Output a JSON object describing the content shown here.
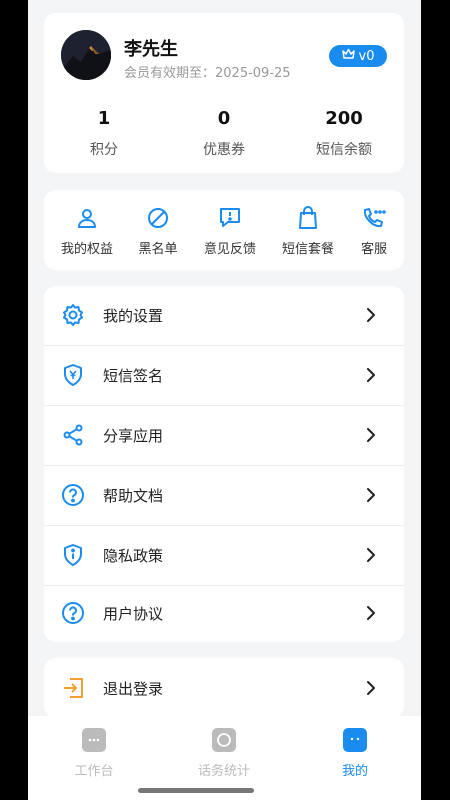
{
  "profile": {
    "name": "李先生",
    "expire_text": "会员有效期至：2025-09-25",
    "vip_level": "v0",
    "stats": [
      {
        "value": "1",
        "label": "积分"
      },
      {
        "value": "0",
        "label": "优惠券"
      },
      {
        "value": "200",
        "label": "短信余额"
      }
    ]
  },
  "quick_actions": [
    {
      "label": "我的权益",
      "icon": "person-icon"
    },
    {
      "label": "黑名单",
      "icon": "block-icon"
    },
    {
      "label": "意见反馈",
      "icon": "feedback-icon"
    },
    {
      "label": "短信套餐",
      "icon": "shopping-bag-icon"
    },
    {
      "label": "客服",
      "icon": "phone-icon"
    }
  ],
  "menu": [
    {
      "label": "我的设置",
      "icon": "gear-icon"
    },
    {
      "label": "短信签名",
      "icon": "shield-yen-icon"
    },
    {
      "label": "分享应用",
      "icon": "share-icon"
    },
    {
      "label": "帮助文档",
      "icon": "help-icon"
    },
    {
      "label": "隐私政策",
      "icon": "info-shield-icon"
    },
    {
      "label": "用户协议",
      "icon": "help-icon"
    }
  ],
  "logout": {
    "label": "退出登录",
    "icon": "logout-icon",
    "color": "#f0a030"
  },
  "tabs": [
    {
      "label": "工作台",
      "icon": "chat-bubble-icon",
      "active": false
    },
    {
      "label": "话务统计",
      "icon": "circle-icon",
      "active": false
    },
    {
      "label": "我的",
      "icon": "face-icon",
      "active": true
    }
  ],
  "colors": {
    "accent": "#1a8cf0",
    "inactive": "#bbbbbb",
    "text": "#222222"
  }
}
